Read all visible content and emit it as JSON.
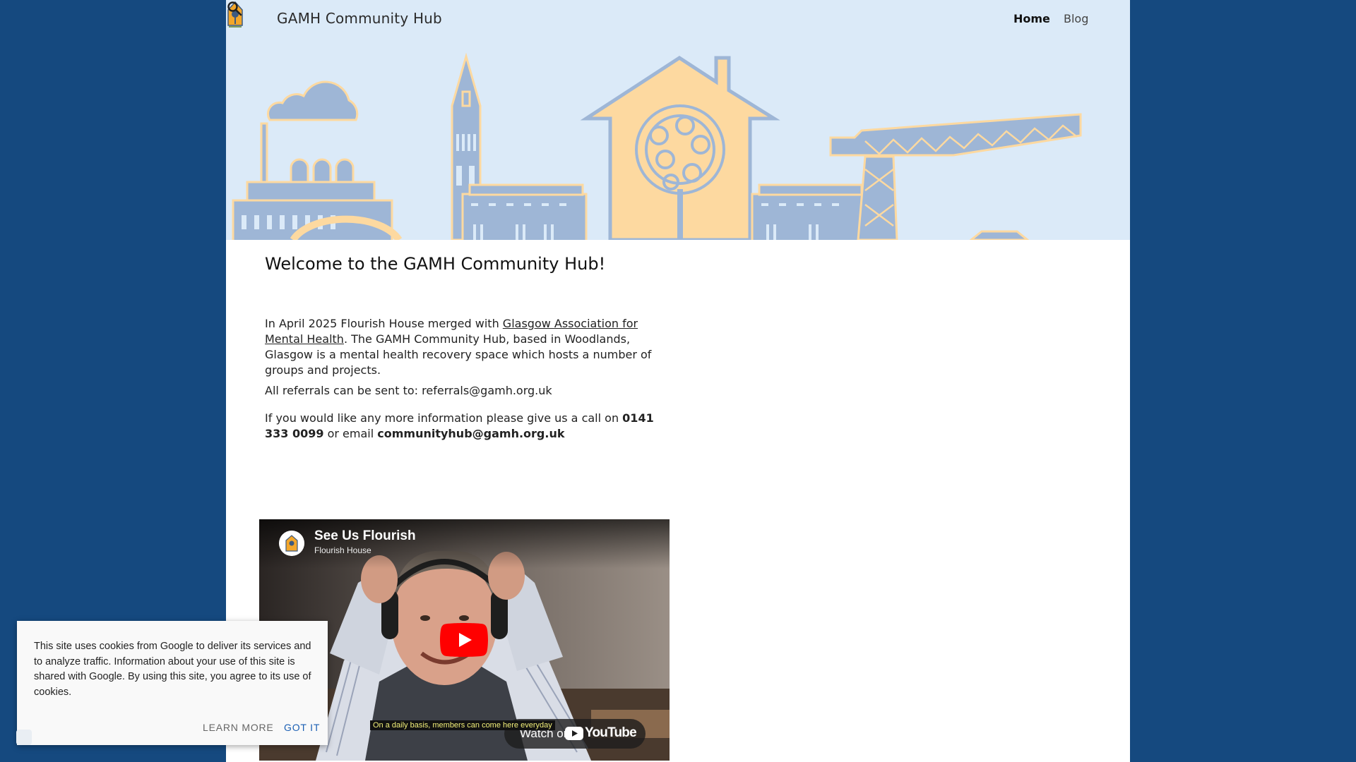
{
  "site": {
    "title": "GAMH Community Hub",
    "logo": "flourish-house-logo"
  },
  "nav": {
    "items": [
      {
        "label": "Home",
        "active": true
      },
      {
        "label": "Blog",
        "active": false
      }
    ],
    "search_icon": "search-icon"
  },
  "banner": {
    "illustration": "glasgow-skyline-illustration",
    "colors": {
      "background": "#dbeaf8",
      "buildings": "#9eb6d6",
      "accent": "#fdd9a0"
    }
  },
  "main": {
    "heading": "Welcome to the GAMH Community Hub!",
    "p1_before": "In April 2025 Flourish House merged with ",
    "p1_link": "Glasgow Association for Mental Health",
    "p1_after": ". The GAMH Community Hub, based in Woodlands, Glasgow is a mental health recovery space which hosts a number of groups and projects.",
    "p2": "All referrals can be sent to: referrals@gamh.org.uk",
    "p3_before": "If you would like any more information please give us a call on ",
    "p3_phone": "0141 333 0099",
    "p3_middle": " or email ",
    "p3_email": "communityhub@gamh.org.uk"
  },
  "video": {
    "title": "See Us Flourish",
    "channel": "Flourish House",
    "caption": "On a daily basis, members can come here everyday",
    "watch_label": "Watch on",
    "youtube_label": "YouTube",
    "play_icon": "play-icon"
  },
  "cookie": {
    "text": "This site uses cookies from Google to deliver its services and to analyze traffic. Information about your use of this site is shared with Google. By using this site, you agree to its use of cookies.",
    "learn_more": "LEARN MORE",
    "got_it": "GOT IT"
  },
  "colors": {
    "page_background": "#15497f",
    "link_accent": "#1a5fb4"
  }
}
